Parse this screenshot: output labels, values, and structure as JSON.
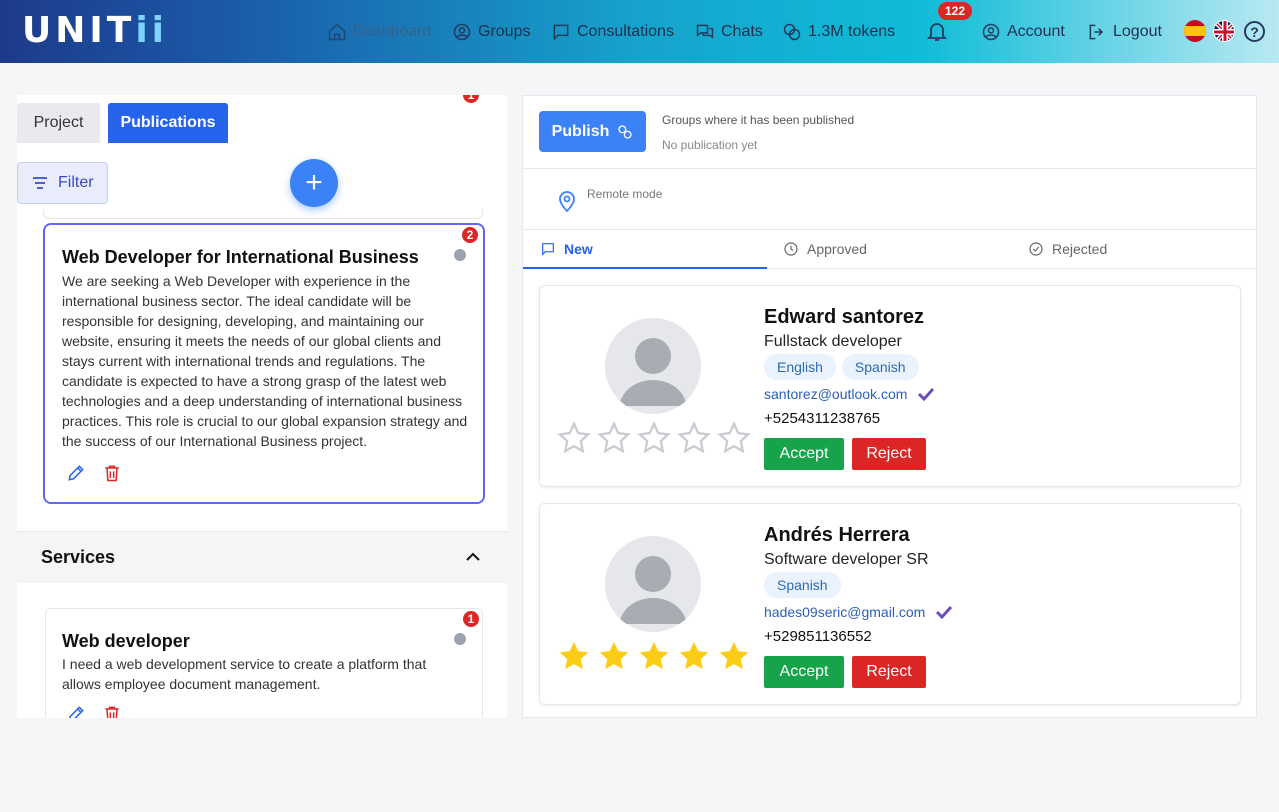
{
  "app": {
    "logo_text": "UNITii"
  },
  "nav": {
    "dashboard": "Dashboard",
    "groups": "Groups",
    "consultations": "Consultations",
    "chats": "Chats",
    "tokens": "1.3M tokens",
    "notifications_count": "122",
    "account": "Account",
    "logout": "Logout",
    "help": "?"
  },
  "left": {
    "tabs": {
      "project": "Project",
      "publications": "Publications"
    },
    "filter_label": "Filter",
    "add_label": "+",
    "top_badge": "1",
    "publication": {
      "title": "Web Developer for International Business",
      "badge": "2",
      "description": "We are seeking a Web Developer with experience in the international business sector. The ideal candidate will be responsible for designing, developing, and maintaining our website, ensuring it meets the needs of our global clients and stays current with international trends and regulations. The candidate is expected to have a strong grasp of the latest web technologies and a deep understanding of international business practices. This role is crucial to our global expansion strategy and the success of our International Business project."
    },
    "services": {
      "heading": "Services",
      "item": {
        "title": "Web developer",
        "badge": "1",
        "description": "I need a web development service to create a platform that allows employee document management."
      }
    }
  },
  "right": {
    "publish_label": "Publish",
    "groups_info": "Groups where it has been published",
    "no_publication": "No publication yet",
    "remote_mode": "Remote mode",
    "tabs": {
      "new": "New",
      "approved": "Approved",
      "rejected": "Rejected"
    },
    "candidates": [
      {
        "name": "Edward santorez",
        "role": "Fullstack developer",
        "languages": [
          "English",
          "Spanish"
        ],
        "email": "santorez@outlook.com",
        "phone": "+5254311238765",
        "rating": 0,
        "accept": "Accept",
        "reject": "Reject"
      },
      {
        "name": "Andrés Herrera",
        "role": "Software developer SR",
        "languages": [
          "Spanish"
        ],
        "email": "hades09seric@gmail.com",
        "phone": "+529851136552",
        "rating": 5,
        "accept": "Accept",
        "reject": "Reject"
      }
    ]
  },
  "colors": {
    "primary": "#2563eb",
    "accept": "#16a34a",
    "reject": "#dc2626",
    "star_filled": "#facc15",
    "star_empty": "#c8ccd2"
  }
}
